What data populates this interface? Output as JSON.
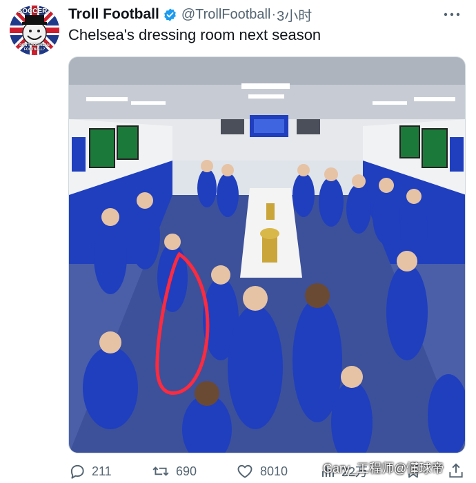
{
  "author": {
    "name": "Troll Football",
    "handle": "@TrollFootball",
    "separator": "·",
    "time": "3小时",
    "avatar_text_top": "SOCCER?",
    "avatar_text_bottom": "DON'T YOU MEAN FOOTBALL?"
  },
  "tweet": {
    "text": "Chelsea's dressing room next season"
  },
  "media": {
    "description": "team-dressing-room-photo",
    "annotation_color": "#ff2a3d",
    "kit_color": "#1f3fbf"
  },
  "actions": {
    "replies": "211",
    "retweets": "690",
    "likes": "8010",
    "views": "22万"
  },
  "watermark": "Gary_工程师@懂球帝",
  "icons": {
    "verified": "verified-badge-icon",
    "more": "more-dots-icon",
    "reply": "reply-icon",
    "retweet": "retweet-icon",
    "like": "heart-icon",
    "views": "views-chart-icon",
    "bookmark": "bookmark-icon",
    "share": "share-icon"
  },
  "colors": {
    "text": "#0f1419",
    "secondary": "#536471",
    "verified": "#1d9bf0"
  }
}
